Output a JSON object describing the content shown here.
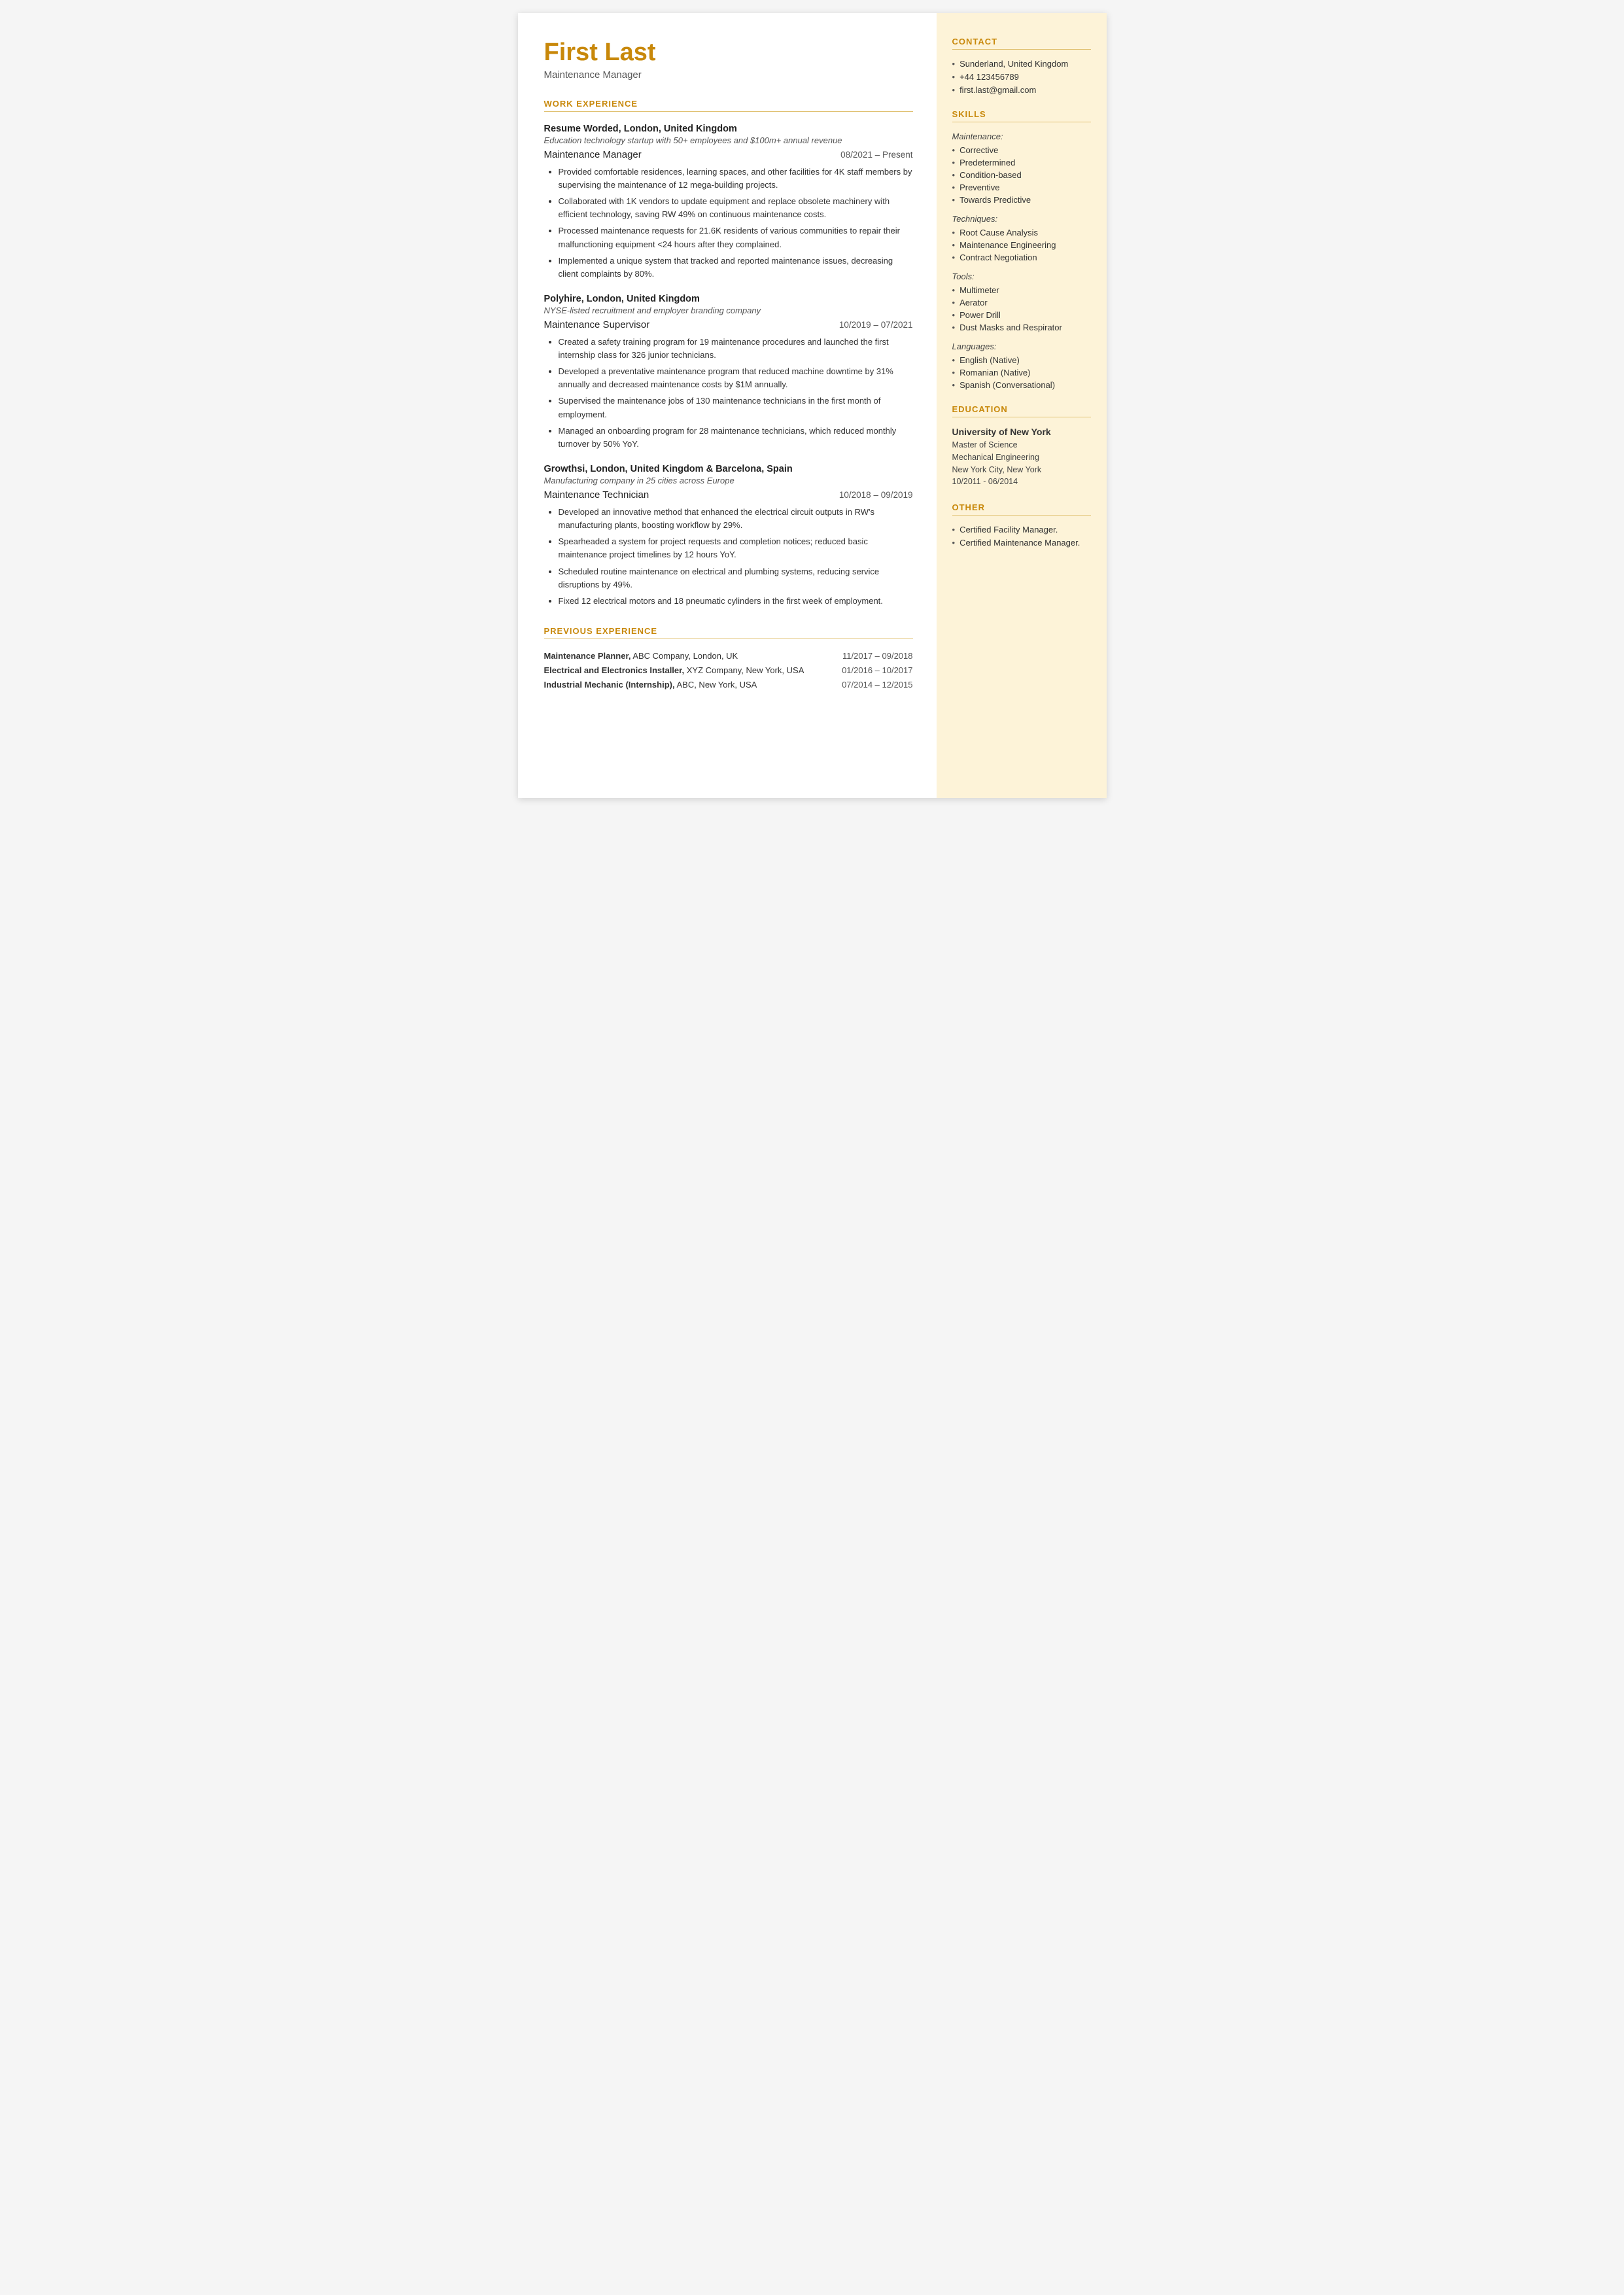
{
  "header": {
    "name": "First Last",
    "job_title": "Maintenance Manager"
  },
  "sections": {
    "work_experience_heading": "WORK EXPERIENCE",
    "previous_experience_heading": "PREVIOUS EXPERIENCE",
    "employers": [
      {
        "company": "Resume Worded,",
        "location": "London, United Kingdom",
        "tagline": "Education technology startup with 50+ employees and $100m+ annual revenue",
        "role": "Maintenance Manager",
        "dates": "08/2021 – Present",
        "bullets": [
          "Provided comfortable residences, learning spaces, and other facilities for 4K staff members by supervising the maintenance of 12 mega-building projects.",
          "Collaborated with 1K vendors to update equipment and replace obsolete machinery with efficient technology, saving RW 49% on continuous maintenance costs.",
          "Processed maintenance requests for 21.6K residents of various communities to repair their malfunctioning equipment <24 hours after they complained.",
          "Implemented a unique system that tracked and reported maintenance issues, decreasing client complaints by 80%."
        ]
      },
      {
        "company": "Polyhire,",
        "location": "London, United Kingdom",
        "tagline": "NYSE-listed recruitment and employer branding company",
        "role": "Maintenance Supervisor",
        "dates": "10/2019 – 07/2021",
        "bullets": [
          "Created a safety training program for 19 maintenance procedures and launched the first internship class for 326 junior technicians.",
          "Developed a preventative maintenance program that reduced machine downtime by 31% annually and decreased maintenance costs by $1M annually.",
          "Supervised the maintenance jobs of 130 maintenance technicians in the first month of employment.",
          "Managed an onboarding program for 28 maintenance technicians, which reduced monthly turnover by 50% YoY."
        ]
      },
      {
        "company": "Growthsi,",
        "location": "London, United Kingdom & Barcelona, Spain",
        "tagline": "Manufacturing company in 25 cities across Europe",
        "role": "Maintenance Technician",
        "dates": "10/2018 – 09/2019",
        "bullets": [
          "Developed an innovative method that enhanced the electrical circuit outputs in RW's manufacturing plants, boosting workflow by 29%.",
          "Spearheaded a system for project requests and completion notices; reduced basic maintenance project timelines by 12 hours YoY.",
          "Scheduled routine maintenance on electrical and plumbing systems, reducing service disruptions by 49%.",
          "Fixed 12 electrical motors and 18 pneumatic cylinders in the first week of employment."
        ]
      }
    ],
    "previous_experience": [
      {
        "role_bold": "Maintenance Planner,",
        "role_rest": " ABC Company, London, UK",
        "dates": "11/2017 – 09/2018"
      },
      {
        "role_bold": "Electrical and Electronics Installer,",
        "role_rest": " XYZ Company, New York, USA",
        "dates": "01/2016 – 10/2017"
      },
      {
        "role_bold": "Industrial Mechanic (Internship),",
        "role_rest": " ABC, New York, USA",
        "dates": "07/2014 – 12/2015"
      }
    ]
  },
  "sidebar": {
    "contact_heading": "CONTACT",
    "contact_items": [
      "Sunderland, United Kingdom",
      "+44 123456789",
      "first.last@gmail.com"
    ],
    "skills_heading": "SKILLS",
    "skill_categories": [
      {
        "label": "Maintenance:",
        "skills": [
          "Corrective",
          "Predetermined",
          "Condition-based",
          "Preventive",
          "Towards Predictive"
        ]
      },
      {
        "label": "Techniques:",
        "skills": [
          "Root Cause Analysis",
          "Maintenance Engineering",
          "Contract Negotiation"
        ]
      },
      {
        "label": "Tools:",
        "skills": [
          "Multimeter",
          "Aerator",
          "Power Drill",
          "Dust Masks and Respirator"
        ]
      },
      {
        "label": "Languages:",
        "skills": [
          "English (Native)",
          "Romanian (Native)",
          "Spanish (Conversational)"
        ]
      }
    ],
    "education_heading": "EDUCATION",
    "education": [
      {
        "institution": "University of New York",
        "degree": "Master of Science",
        "field": "Mechanical Engineering",
        "location": "New York City, New York",
        "dates": "10/2011 - 06/2014"
      }
    ],
    "other_heading": "OTHER",
    "other_items": [
      "Certified Facility Manager.",
      "Certified Maintenance Manager."
    ]
  }
}
